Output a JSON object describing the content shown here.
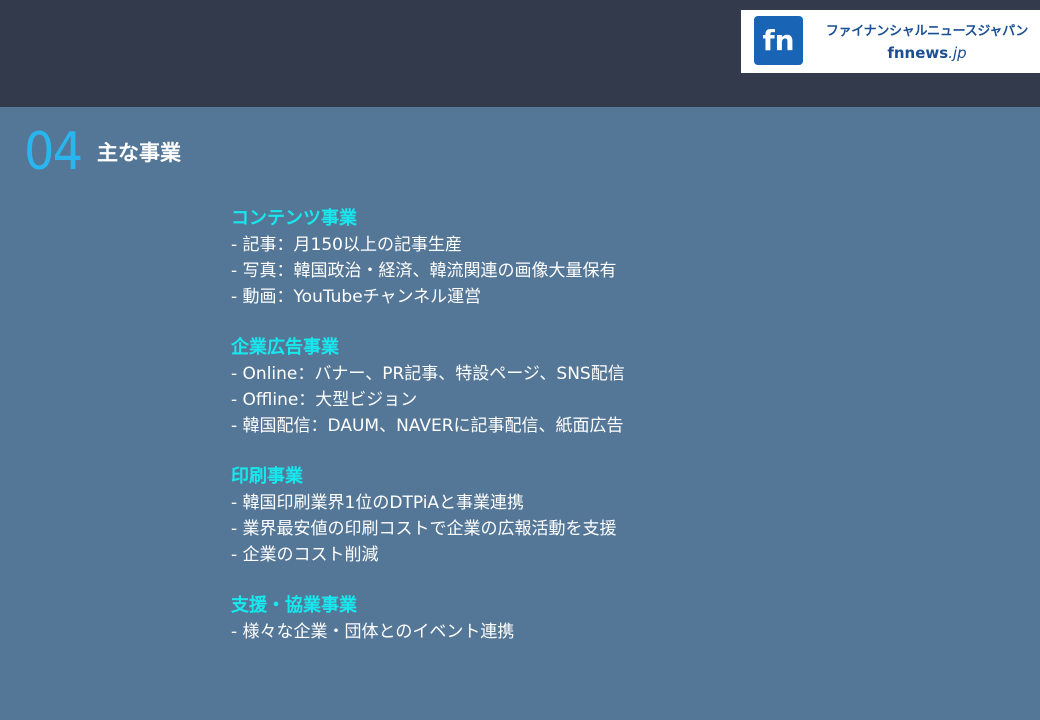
{
  "header": {
    "logo": {
      "mark_text": "fn",
      "name": "ファイナンシャルニュースジャパン",
      "domain_main": "fnnews",
      "domain_tld": ".jp",
      "brand_color": "#1a64b5"
    }
  },
  "section": {
    "number": "04",
    "title": "主な事業"
  },
  "groups": [
    {
      "heading": "コンテンツ事業",
      "items": [
        "- 記事：月150以上の記事生産",
        "- 写真：韓国政治・経済、韓流関連の画像大量保有",
        "- 動画：YouTubeチャンネル運営"
      ]
    },
    {
      "heading": "企業広告事業",
      "items": [
        "- Online：バナー、PR記事、特設ページ、SNS配信",
        "- Offline：大型ビジョン",
        "- 韓国配信：DAUM、NAVERに記事配信、紙面広告"
      ]
    },
    {
      "heading": "印刷事業",
      "items": [
        "- 韓国印刷業界1位のDTPiAと事業連携",
        "- 業界最安値の印刷コストで企業の広報活動を支援",
        "- 企業のコスト削減"
      ]
    },
    {
      "heading": "支援・協業事業",
      "items": [
        "- 様々な企業・団体とのイベント連携"
      ]
    }
  ],
  "colors": {
    "background": "#557797",
    "top_bar": "#323a4b",
    "accent_number": "#29b6f0",
    "heading": "#17e8ee"
  }
}
